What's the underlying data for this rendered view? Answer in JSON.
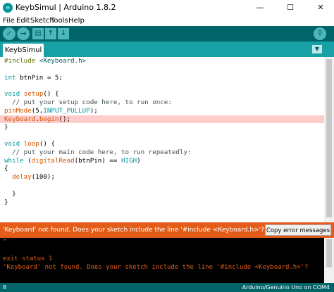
{
  "window": {
    "title": "KeybSimul | Arduino 1.8.2",
    "app_icon_text": "∞",
    "minimize": "—",
    "maximize": "☐",
    "close": "✕"
  },
  "menu": [
    "File",
    "Edit",
    "Sketch",
    "Tools",
    "Help"
  ],
  "toolbar": {
    "verify_icon": "✓",
    "upload_icon": "→",
    "new_icon": "▤",
    "open_icon": "↑",
    "save_icon": "↓",
    "serial_icon": "⚲"
  },
  "tabs": {
    "active": "KeybSimul",
    "menu_icon": "▼"
  },
  "code_lines": [
    {
      "segs": [
        {
          "t": "#include ",
          "c": "dirv"
        },
        {
          "t": "<Keyboard.h>",
          "c": "str"
        }
      ]
    },
    {
      "segs": []
    },
    {
      "segs": [
        {
          "t": "int",
          "c": "kw"
        },
        {
          "t": " btnPin = 5;",
          "c": ""
        }
      ]
    },
    {
      "segs": []
    },
    {
      "segs": [
        {
          "t": "void",
          "c": "kw"
        },
        {
          "t": " ",
          "c": ""
        },
        {
          "t": "setup",
          "c": "fn"
        },
        {
          "t": "() {",
          "c": ""
        }
      ]
    },
    {
      "segs": [
        {
          "t": "  // put your setup code here, to run once:",
          "c": "cm"
        }
      ]
    },
    {
      "segs": [
        {
          "t": "pinMode",
          "c": "fn"
        },
        {
          "t": "(5,",
          "c": ""
        },
        {
          "t": "INPUT_PULLUP",
          "c": "const"
        },
        {
          "t": ");",
          "c": ""
        }
      ]
    },
    {
      "segs": [
        {
          "t": "Keyboard",
          "c": "fn"
        },
        {
          "t": ".",
          "c": ""
        },
        {
          "t": "begin",
          "c": "fn"
        },
        {
          "t": "();",
          "c": ""
        }
      ],
      "error": true
    },
    {
      "segs": [
        {
          "t": "}",
          "c": ""
        }
      ]
    },
    {
      "segs": []
    },
    {
      "segs": [
        {
          "t": "void",
          "c": "kw"
        },
        {
          "t": " ",
          "c": ""
        },
        {
          "t": "loop",
          "c": "fn"
        },
        {
          "t": "() {",
          "c": ""
        }
      ]
    },
    {
      "segs": [
        {
          "t": "  // put your main code here, to run repeatedly:",
          "c": "cm"
        }
      ]
    },
    {
      "segs": [
        {
          "t": "while",
          "c": "kw"
        },
        {
          "t": " (",
          "c": ""
        },
        {
          "t": "digitalRead",
          "c": "fn"
        },
        {
          "t": "(btnPin) == ",
          "c": ""
        },
        {
          "t": "HIGH",
          "c": "const"
        },
        {
          "t": ")",
          "c": ""
        }
      ]
    },
    {
      "segs": [
        {
          "t": "{",
          "c": ""
        }
      ]
    },
    {
      "segs": [
        {
          "t": "  ",
          "c": ""
        },
        {
          "t": "delay",
          "c": "fn"
        },
        {
          "t": "(100);",
          "c": ""
        }
      ]
    },
    {
      "segs": []
    },
    {
      "segs": [
        {
          "t": "  }",
          "c": ""
        }
      ]
    },
    {
      "segs": [
        {
          "t": "}",
          "c": ""
        }
      ]
    }
  ],
  "status": {
    "message": "'Keyboard' not found. Does your sketch include the line '#include <Keyboard.h>'?",
    "copy_button": "Copy error messages"
  },
  "console_lines": [
    "^",
    "",
    "exit status 1",
    "'Keyboard' not found. Does your sketch include the line '#include <Keyboard.h>'?"
  ],
  "bottom": {
    "line_number": "8",
    "board": "Arduino/Genuino Uno on COM4"
  },
  "colors": {
    "toolbar_bg": "#006468",
    "tabbar_bg": "#17a1a5",
    "error_bg": "#e35d19",
    "error_line": "#ffcccc",
    "keyword": "#00979c",
    "function": "#d35400"
  }
}
